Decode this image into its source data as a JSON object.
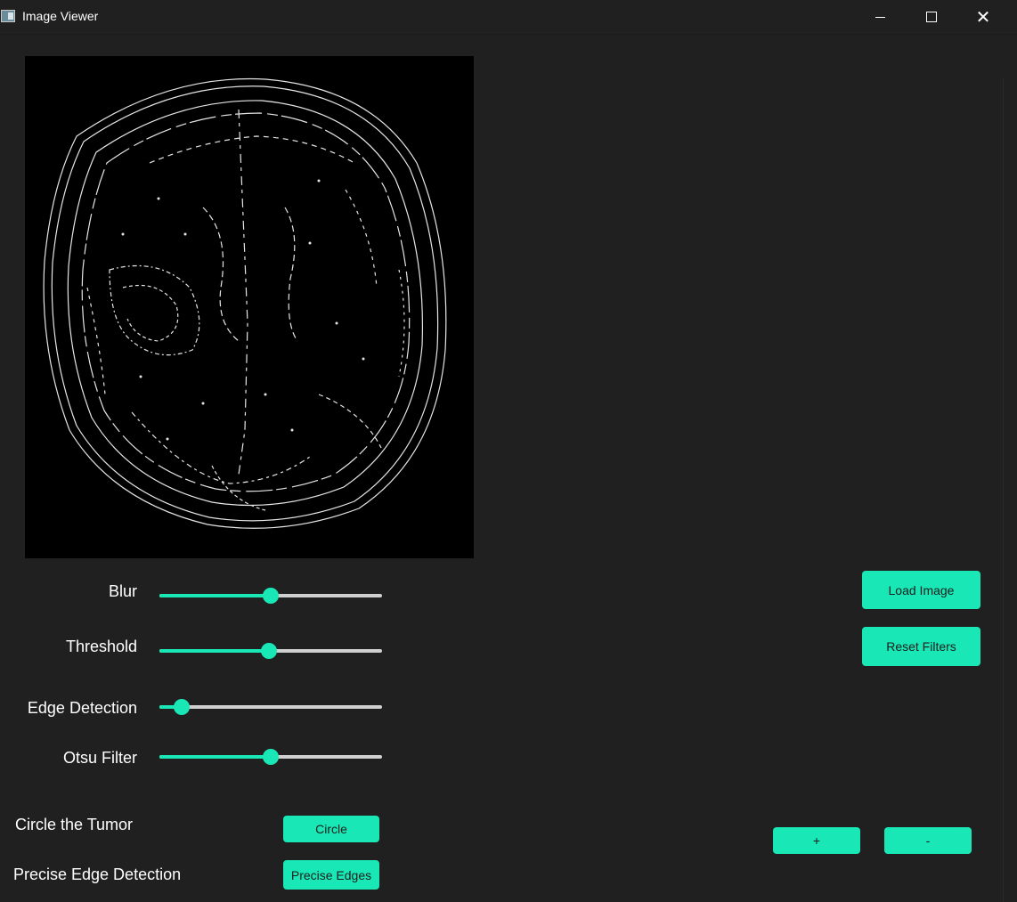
{
  "window": {
    "title": "Image Viewer"
  },
  "sliders": [
    {
      "label": "Blur",
      "value": 0.5
    },
    {
      "label": "Threshold",
      "value": 0.49
    },
    {
      "label": "Edge Detection",
      "value": 0.1
    },
    {
      "label": "Otsu Filter",
      "value": 0.5
    }
  ],
  "actions": {
    "circle_label": "Circle the Tumor",
    "circle_button": "Circle",
    "precise_label": "Precise Edge Detection",
    "precise_button": "Precise Edges"
  },
  "buttons": {
    "load_image": "Load Image",
    "reset_filters": "Reset Filters",
    "zoom_in": "+",
    "zoom_out": "-"
  },
  "colors": {
    "background": "#202020",
    "accent": "#19e8b6",
    "track": "#d0d0d0",
    "image_background": "#000000",
    "edges": "#e6e6e6"
  }
}
